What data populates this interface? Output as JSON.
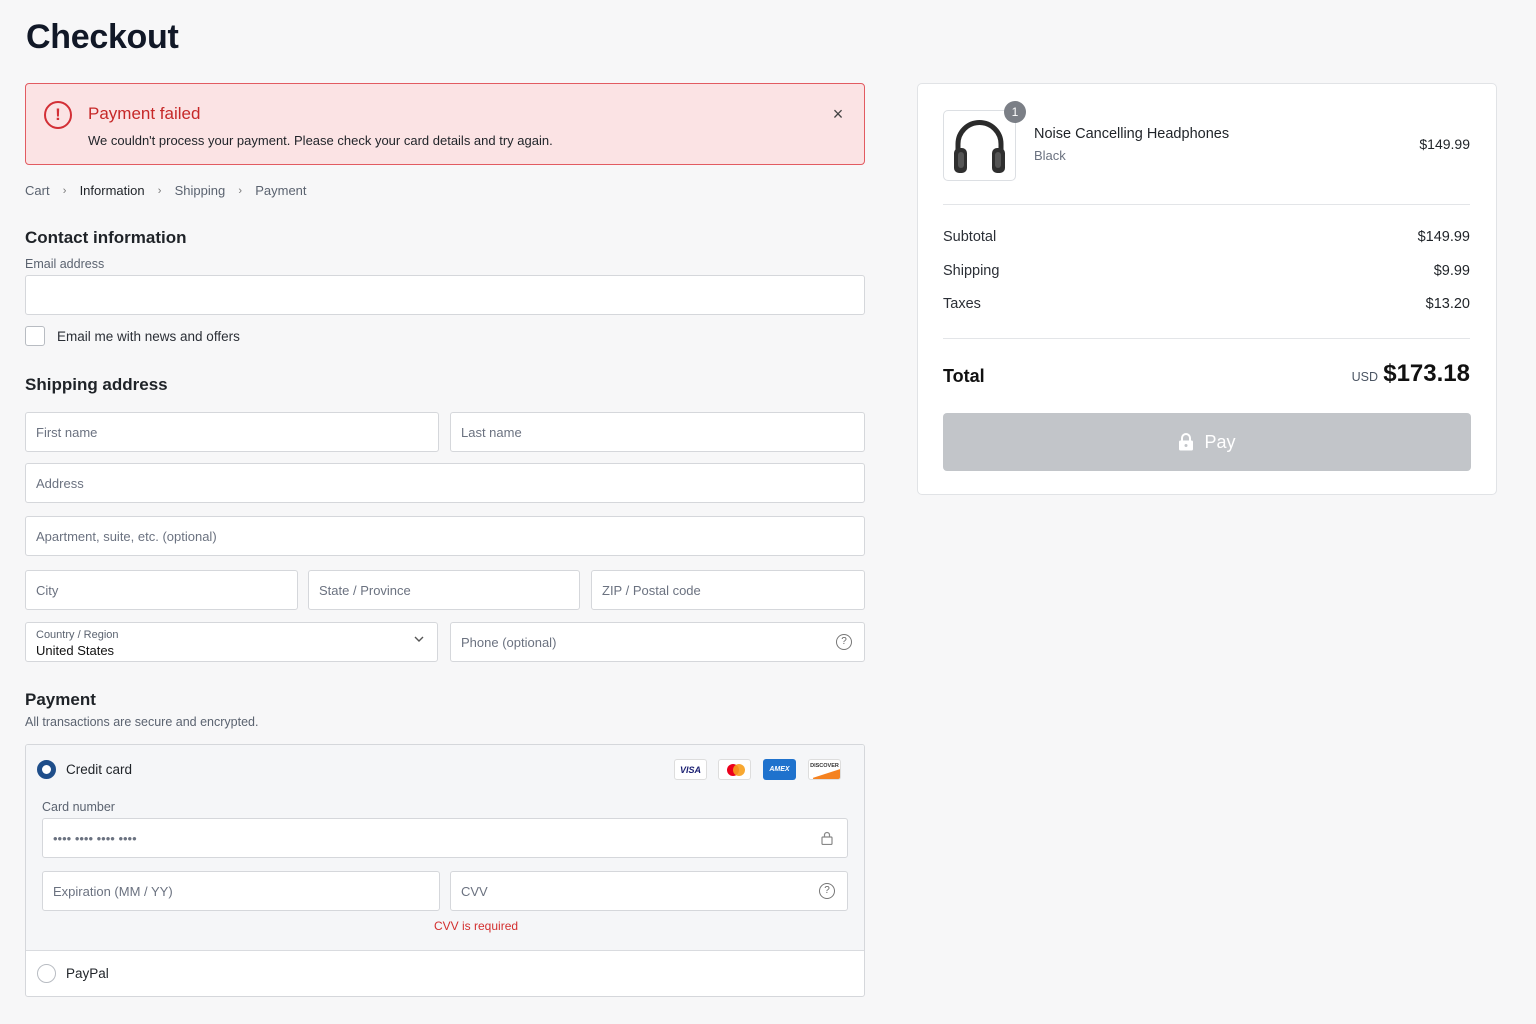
{
  "page": {
    "title": "Checkout"
  },
  "alert": {
    "title": "Payment failed",
    "message": "We couldn't process your payment. Please check your card details and try again.",
    "icon": "!",
    "close": "×"
  },
  "breadcrumb": {
    "items": [
      "Cart",
      "Information",
      "Shipping",
      "Payment"
    ],
    "separator": "›"
  },
  "contact": {
    "title": "Contact information",
    "email_label": "Email address",
    "email_value": "",
    "newsletter_label": "Email me with news and offers"
  },
  "shipping": {
    "title": "Shipping address",
    "first_name_placeholder": "First name",
    "last_name_placeholder": "Last name",
    "address_placeholder": "Address",
    "apartment_placeholder": "Apartment, suite, etc. (optional)",
    "city_placeholder": "City",
    "state_placeholder": "State / Province",
    "zip_placeholder": "ZIP / Postal code",
    "country_label": "Country / Region",
    "country_value": "United States",
    "phone_placeholder": "Phone (optional)",
    "help_glyph": "?"
  },
  "payment": {
    "title": "Payment",
    "subtitle": "All transactions are secure and encrypted.",
    "credit_card_label": "Credit card",
    "card_number_label": "Card number",
    "card_number_placeholder": "•••• •••• •••• ••••",
    "expiration_placeholder": "Expiration (MM / YY)",
    "cvv_placeholder": "CVV",
    "cvv_error": "CVV is required",
    "paypal_label": "PayPal",
    "logos": {
      "visa": "VISA",
      "amex": "AMEX",
      "discover": "DISCOVER"
    },
    "selected_method": "credit-card"
  },
  "summary": {
    "item": {
      "name": "Noise Cancelling Headphones",
      "variant": "Black",
      "price": "$149.99",
      "quantity": "1"
    },
    "subtotal_label": "Subtotal",
    "subtotal_value": "$149.99",
    "shipping_label": "Shipping",
    "shipping_value": "$9.99",
    "taxes_label": "Taxes",
    "taxes_value": "$13.20",
    "total_label": "Total",
    "total_currency": "USD",
    "total_value": "$173.18",
    "pay_label": "Pay"
  },
  "colors": {
    "error": "#d32f36",
    "error_bg": "#fbe3e4",
    "radio_selected": "#1f4e8a",
    "pay_disabled": "#c2c5c9"
  }
}
